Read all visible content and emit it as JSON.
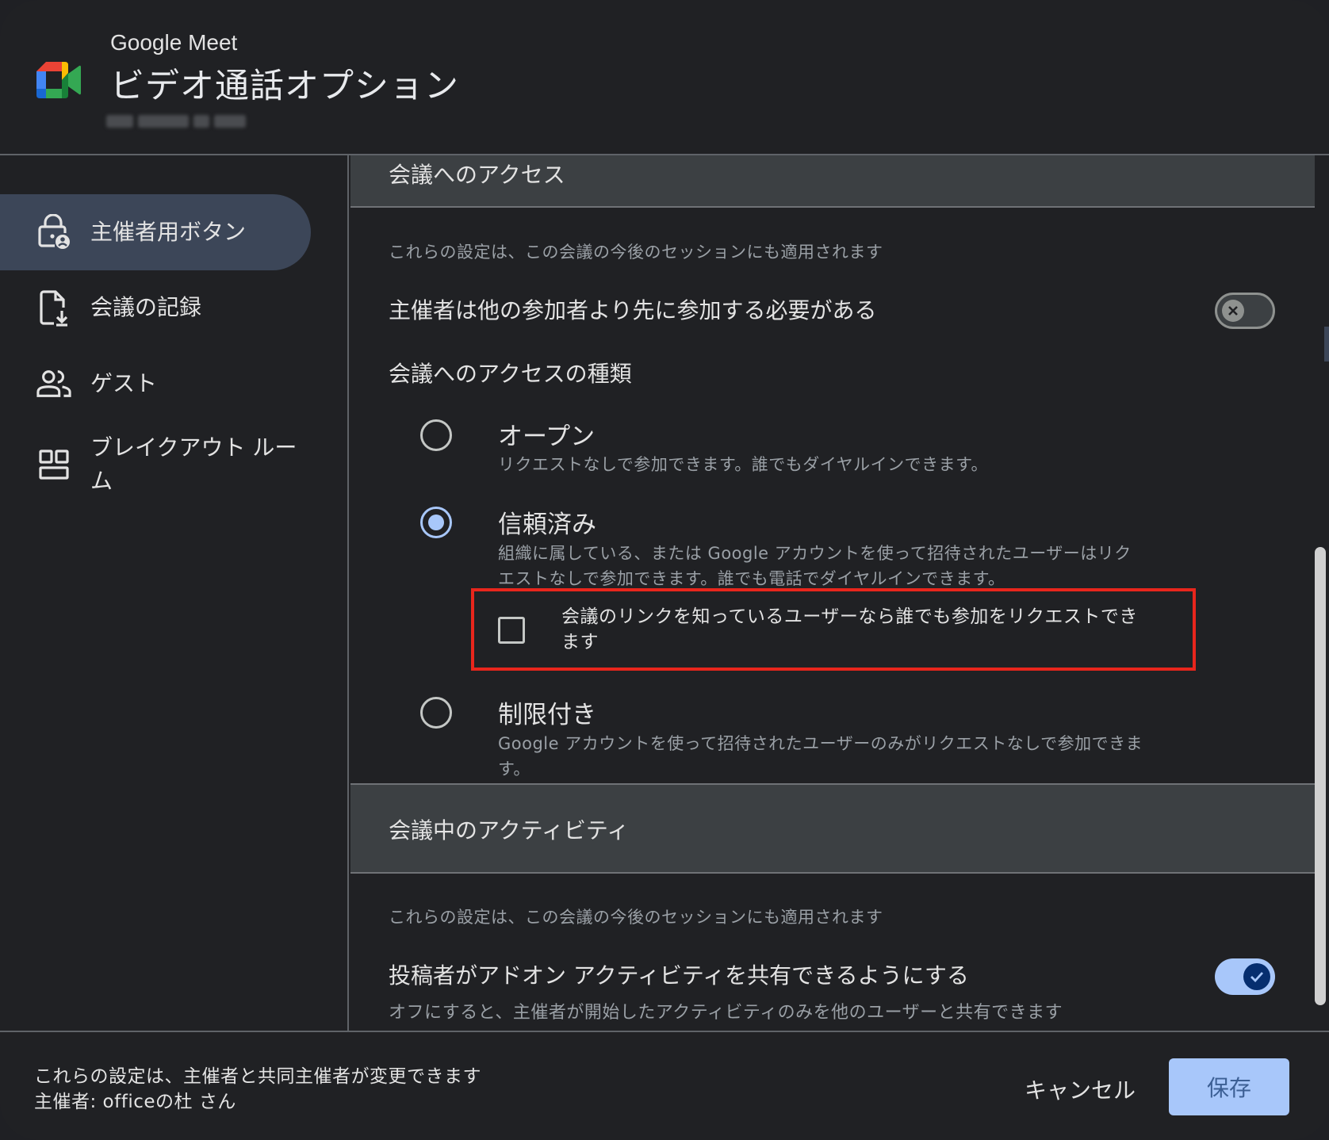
{
  "header": {
    "app_name": "Google Meet",
    "title": "ビデオ通話オプション"
  },
  "sidebar": {
    "items": [
      {
        "label": "主催者用ボタン",
        "icon": "lock-person-icon",
        "active": true
      },
      {
        "label": "会議の記録",
        "icon": "file-download-icon",
        "active": false
      },
      {
        "label": "ゲスト",
        "icon": "people-icon",
        "active": false
      },
      {
        "label": "ブレイクアウト ルーム",
        "icon": "grid-icon",
        "active": false
      }
    ]
  },
  "access_section": {
    "title": "会議へのアクセス",
    "note": "これらの設定は、この会議の今後のセッションにも適用されます",
    "host_first_label": "主催者は他の参加者より先に参加する必要がある",
    "host_first_on": false,
    "access_type_label": "会議へのアクセスの種類",
    "options": [
      {
        "title": "オープン",
        "desc": "リクエストなしで参加できます。誰でもダイヤルインできます。",
        "selected": false
      },
      {
        "title": "信頼済み",
        "desc": "組織に属している、または Google アカウントを使って招待されたユーザーはリクエストなしで参加できます。誰でも電話でダイヤルインできます。",
        "selected": true
      },
      {
        "title": "制限付き",
        "desc": "Google アカウントを使って招待されたユーザーのみがリクエストなしで参加できます。",
        "selected": false
      }
    ],
    "link_request_label": "会議のリンクを知っているユーザーなら誰でも参加をリクエストできます",
    "link_request_checked": false
  },
  "activity_section": {
    "title": "会議中のアクティビティ",
    "note": "これらの設定は、この会議の今後のセッションにも適用されます",
    "addon_label": "投稿者がアドオン アクティビティを共有できるようにする",
    "addon_on": true,
    "addon_desc": "オフにすると、主催者が開始したアクティビティのみを他のユーザーと共有できます"
  },
  "footer": {
    "line1": "これらの設定は、主催者と共同主催者が変更できます",
    "line2": "主催者: officeの杜 さん",
    "cancel_label": "キャンセル",
    "save_label": "保存"
  },
  "colors": {
    "accent": "#a8c7fa",
    "highlight": "#e8261c",
    "background": "#202124"
  }
}
